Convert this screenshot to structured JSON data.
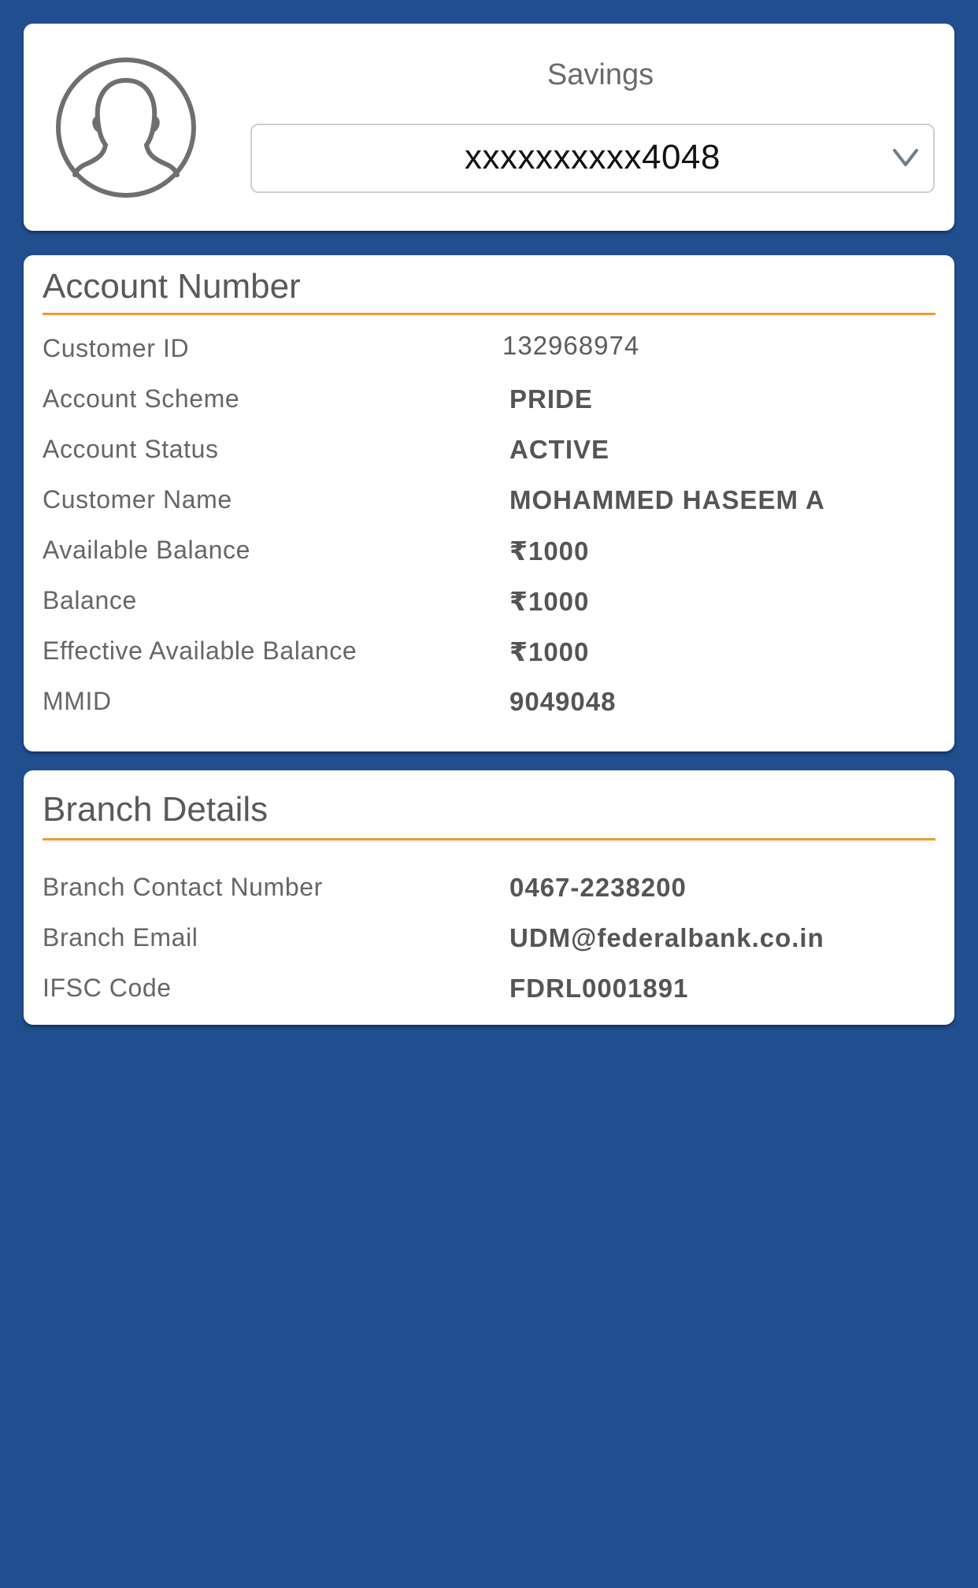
{
  "profile": {
    "account_type": "Savings",
    "account_number_masked": "xxxxxxxxxx4048",
    "avatar_icon": "user-avatar-icon",
    "dropdown_icon": "chevron-down-icon"
  },
  "account": {
    "title": "Account Number",
    "rows": [
      {
        "label": "Customer ID",
        "value": "132968974"
      },
      {
        "label": "Account Scheme",
        "value": "PRIDE"
      },
      {
        "label": "Account Status",
        "value": "ACTIVE"
      },
      {
        "label": "Customer Name",
        "value": "MOHAMMED HASEEM A"
      },
      {
        "label": "Available Balance",
        "value": "₹1000"
      },
      {
        "label": "Balance",
        "value": "₹1000"
      },
      {
        "label": "Effective Available Balance",
        "value": "₹1000"
      },
      {
        "label": "MMID",
        "value": "9049048"
      }
    ]
  },
  "branch": {
    "title": "Branch Details",
    "rows": [
      {
        "label": "Branch Contact Number",
        "value": "0467-2238200"
      },
      {
        "label": "Branch Email",
        "value": "UDM@federalbank.co.in"
      },
      {
        "label": "IFSC Code",
        "value": "FDRL0001891"
      }
    ]
  },
  "colors": {
    "background": "#214e8f",
    "card": "#ffffff",
    "accent_rule": "#f09a2c",
    "label_text": "#666666",
    "value_text": "#555555"
  }
}
